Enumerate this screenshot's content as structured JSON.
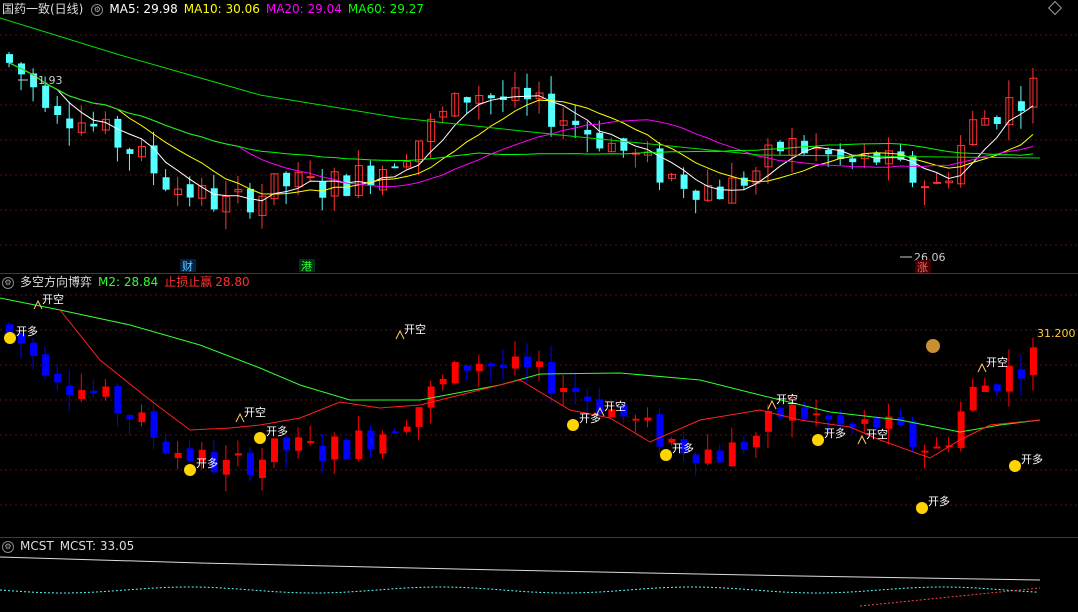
{
  "main_panel": {
    "title": "国药一致(日线)",
    "ma5": "MA5: 29.98",
    "ma10": "MA10: 30.06",
    "ma20": "MA20: 29.04",
    "ma60": "MA60: 29.27",
    "high_label": "31.93",
    "low_label": "26.06",
    "event_labels": [
      "财",
      "港",
      "涨"
    ],
    "colors": {
      "ma5": "#ffffff",
      "ma10": "#ffff00",
      "ma20": "#ff00ff",
      "ma60": "#00ff00",
      "up": "#ff3333",
      "down": "#54ffff"
    }
  },
  "sub_panel": {
    "title": "多空方向博弈",
    "m2": "M2: 28.84",
    "stop_label": "止损止赢",
    "stop_value": "28.80",
    "price_tag": "31.200",
    "signal_long": "开多",
    "signal_short": "开空",
    "colors": {
      "up": "#ff0000",
      "down": "#0000ff",
      "line_red": "#ff2020",
      "line_green": "#30ff30"
    }
  },
  "mcst_panel": {
    "title": "MCST",
    "value": "MCST: 33.05"
  },
  "chart_data": {
    "type": "candlestick",
    "series_names": [
      "MA5",
      "MA10",
      "MA20",
      "MA60"
    ],
    "approx_close": [
      31.2,
      30.5,
      29.8,
      29.3,
      28.8,
      28.0,
      27.6,
      27.3,
      27.6,
      27.9,
      27.8,
      28.0,
      28.4,
      29.0,
      29.8,
      30.5,
      30.2,
      30.0,
      29.7,
      29.2,
      28.7,
      28.2,
      27.9,
      27.7,
      28.2,
      29.0,
      28.8,
      28.4,
      28.6,
      28.1,
      27.8,
      29.5,
      30.0,
      30.6
    ],
    "y_range": [
      25.5,
      32.5
    ]
  }
}
